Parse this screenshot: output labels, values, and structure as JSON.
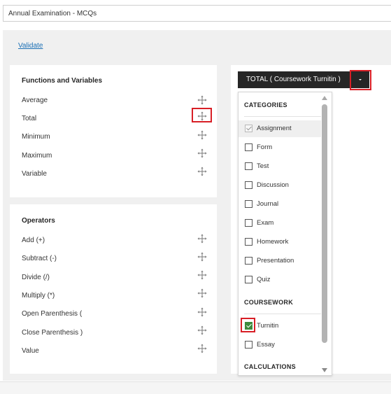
{
  "assessment": {
    "title": "Annual Examination - MCQs"
  },
  "validate_link": "Validate",
  "functions_panel": {
    "heading": "Functions and Variables",
    "items": [
      {
        "label": "Average"
      },
      {
        "label": "Total"
      },
      {
        "label": "Minimum"
      },
      {
        "label": "Maximum"
      },
      {
        "label": "Variable"
      }
    ]
  },
  "operators_panel": {
    "heading": "Operators",
    "items": [
      {
        "label": "Add (+)"
      },
      {
        "label": "Subtract (-)"
      },
      {
        "label": "Divide (/)"
      },
      {
        "label": "Multiply (*)"
      },
      {
        "label": "Open Parenthesis ("
      },
      {
        "label": "Close Parenthesis )"
      },
      {
        "label": "Value"
      }
    ]
  },
  "formula_dropdown": {
    "selected_label": "TOTAL ( Coursework Turnitin )",
    "sections": {
      "categories": {
        "heading": "CATEGORIES",
        "options": [
          {
            "label": "Assignment",
            "checked": true,
            "disabled": true
          },
          {
            "label": "Form",
            "checked": false
          },
          {
            "label": "Test",
            "checked": false
          },
          {
            "label": "Discussion",
            "checked": false
          },
          {
            "label": "Journal",
            "checked": false
          },
          {
            "label": "Exam",
            "checked": false
          },
          {
            "label": "Homework",
            "checked": false
          },
          {
            "label": "Presentation",
            "checked": false
          },
          {
            "label": "Quiz",
            "checked": false
          }
        ]
      },
      "coursework": {
        "heading": "COURSEWORK",
        "options": [
          {
            "label": "Turnitin",
            "checked": true
          },
          {
            "label": "Essay",
            "checked": false
          }
        ]
      },
      "calculations": {
        "heading": "CALCULATIONS"
      }
    }
  },
  "icons": {
    "move": "move-arrows-icon",
    "caret": "caret-down-icon",
    "check": "checkmark-icon"
  },
  "colors": {
    "highlight": "#d81f26",
    "dropdown_bg": "#262626",
    "link": "#1a6fb5",
    "checkbox_green": "#3d8a3d"
  }
}
